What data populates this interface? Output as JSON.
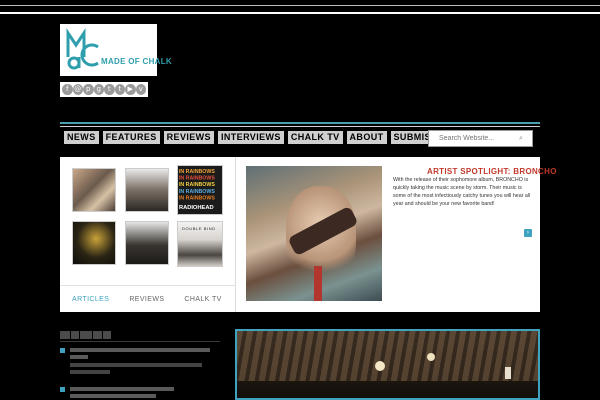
{
  "logo": {
    "text": "MADE OF CHALK",
    "mark": "MC"
  },
  "social": {
    "icons": [
      {
        "name": "facebook-icon",
        "glyph": "f"
      },
      {
        "name": "email-icon",
        "glyph": "@"
      },
      {
        "name": "pinterest-icon",
        "glyph": "p"
      },
      {
        "name": "google-plus-icon",
        "glyph": "g"
      },
      {
        "name": "tumblr-icon",
        "glyph": "t"
      },
      {
        "name": "twitter-icon",
        "glyph": "t"
      },
      {
        "name": "youtube-icon",
        "glyph": "▶"
      },
      {
        "name": "vimeo-icon",
        "glyph": "v"
      }
    ]
  },
  "nav": {
    "items": [
      "NEWS",
      "FEATURES",
      "REVIEWS",
      "INTERVIEWS",
      "CHALK TV",
      "ABOUT",
      "SUBMISSIONS"
    ]
  },
  "search": {
    "placeholder": "Search Website...",
    "icon": "search-icon"
  },
  "thumbs": {
    "t3_lines": [
      "IN RAINBOWS",
      "IN RAINBOWS",
      "IN RAINBOWS",
      "IN RAINBOWS",
      "IN RAINBOWS",
      "RADIOHEAD"
    ],
    "t6_label": "DOUBLE BIND"
  },
  "tabs": [
    "ARTICLES",
    "REVIEWS",
    "CHALK TV"
  ],
  "spotlight": {
    "title": "ARTIST SPOTLIGHT: BRONCHO",
    "text": "With the release of their sophomore album, BRONCHO is quickly taking the music scene by storm. Their music is some of the most infectiously catchy tunes you will hear all year and should be your new favorite band!",
    "next_glyph": "›"
  },
  "colors": {
    "accent": "#3fa3c0",
    "spotlight_title": "#c0392b",
    "background": "#000000"
  }
}
